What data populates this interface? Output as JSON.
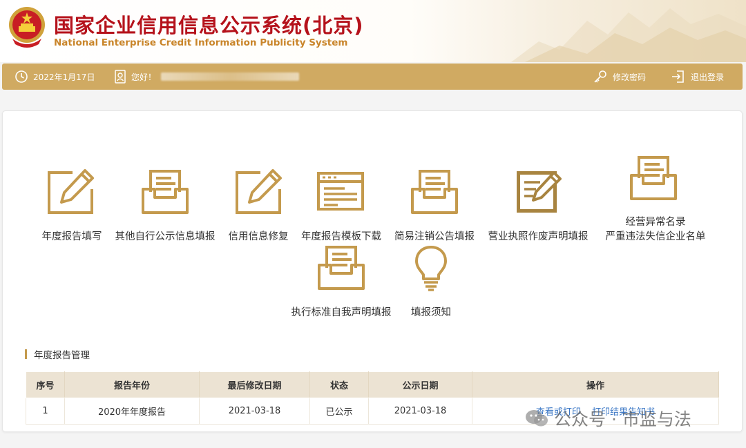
{
  "header": {
    "title_cn": "国家企业信用信息公示系统(北京)",
    "title_en": "National Enterprise Credit Information Publicity System"
  },
  "toolbar": {
    "date": "2022年1月17日",
    "greeting": "您好！",
    "change_password": "修改密码",
    "logout": "退出登录"
  },
  "tiles": [
    {
      "id": "annual-report-fill",
      "label": "年度报告填写",
      "icon": "pencil-icon"
    },
    {
      "id": "other-public-info",
      "label": "其他自行公示信息填报",
      "icon": "inbox-icon"
    },
    {
      "id": "credit-repair",
      "label": "信用信息修复",
      "icon": "pencil-icon"
    },
    {
      "id": "template-download",
      "label": "年度报告模板下载",
      "icon": "browser-window-icon"
    },
    {
      "id": "simple-deregistration",
      "label": "简易注销公告填报",
      "icon": "inbox-icon"
    },
    {
      "id": "license-void",
      "label": "营业执照作废声明填报",
      "icon": "edit-document-icon"
    },
    {
      "id": "abnormal-list",
      "label": "经营异常名录",
      "label2": "严重违法失信企业名单",
      "icon": "inbox-icon"
    },
    {
      "id": "standard-declaration",
      "label": "执行标准自我声明填报",
      "icon": "inbox-icon"
    },
    {
      "id": "filing-notice",
      "label": "填报须知",
      "icon": "lightbulb-icon"
    }
  ],
  "section": {
    "title": "年度报告管理"
  },
  "table": {
    "headers": [
      "序号",
      "报告年份",
      "最后修改日期",
      "状态",
      "公示日期",
      "操作"
    ],
    "rows": [
      {
        "no": "1",
        "year": "2020年年度报告",
        "modified": "2021-03-18",
        "status": "已公示",
        "published": "2021-03-18",
        "op1": "查看或打印",
        "op2": "打印结果告知书"
      }
    ]
  },
  "watermark": {
    "text": "公众号 · 市监与法"
  },
  "colors": {
    "gold": "#c49a4d",
    "toolbar": "#d0aa62",
    "brand_red": "#b5121b",
    "link": "#3c78c6"
  }
}
